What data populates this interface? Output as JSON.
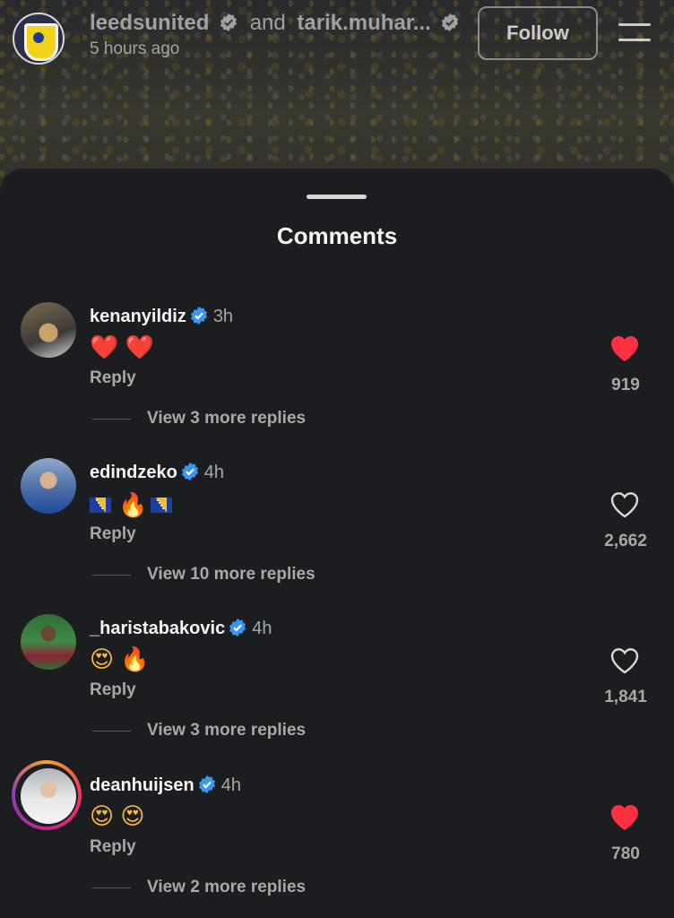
{
  "header": {
    "account_primary": "leedsunited",
    "connector": "and",
    "account_secondary": "tarik.muhar...",
    "time": "5 hours ago",
    "follow_label": "Follow"
  },
  "sheet": {
    "title": "Comments"
  },
  "icons": {
    "verified": "verified-badge-icon",
    "heart_filled": "heart-filled-icon",
    "heart_outline": "heart-outline-icon",
    "menu": "menu-icon"
  },
  "colors": {
    "verified_blue": "#3897f0",
    "liked_red": "#ff3040",
    "background": "#1c1d20",
    "muted_text": "#a8a8a8"
  },
  "comments": [
    {
      "username": "kenanyildiz",
      "time": "3h",
      "emoji_text": "❤️ ❤️",
      "reply_label": "Reply",
      "view_replies": "View 3 more replies",
      "likes": "919",
      "liked": true
    },
    {
      "username": "edindzeko",
      "time": "4h",
      "emoji_text": "🔥",
      "reply_label": "Reply",
      "view_replies": "View 10 more replies",
      "likes": "2,662",
      "liked": false
    },
    {
      "username": "_haristabakovic",
      "time": "4h",
      "emoji_text": "😍 🔥",
      "reply_label": "Reply",
      "view_replies": "View 3 more replies",
      "likes": "1,841",
      "liked": false
    },
    {
      "username": "deanhuijsen",
      "time": "4h",
      "emoji_text": "😍 😍",
      "reply_label": "Reply",
      "view_replies": "View 2 more replies",
      "likes": "780",
      "liked": true
    }
  ]
}
